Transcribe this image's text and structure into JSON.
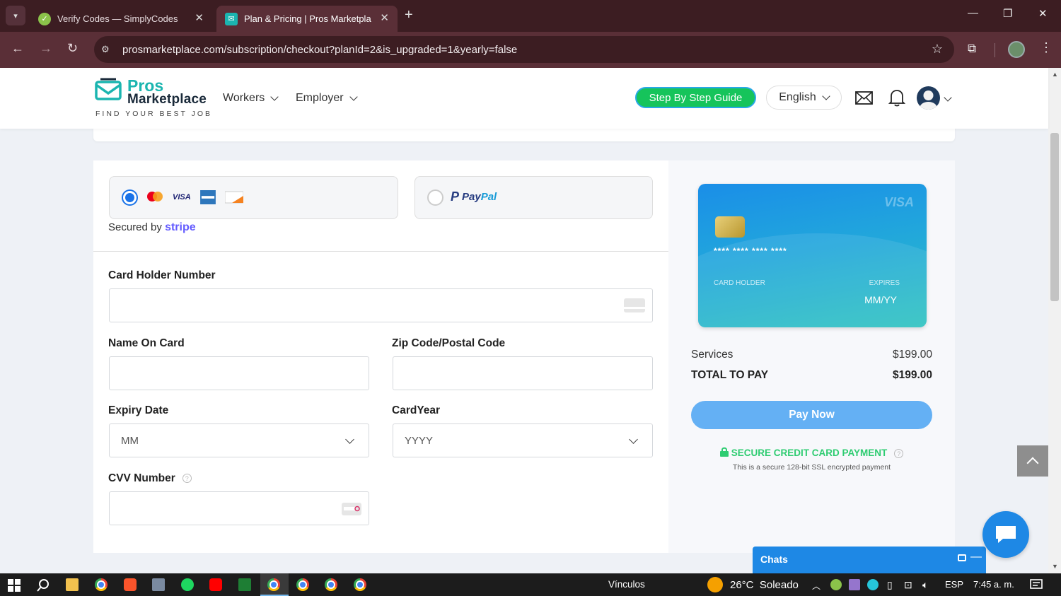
{
  "browser": {
    "tabs": [
      {
        "title": "Verify Codes — SimplyCodes",
        "active": false
      },
      {
        "title": "Plan & Pricing | Pros Marketplace",
        "active": true
      }
    ],
    "url": "prosmarketplace.com/subscription/checkout?planId=2&is_upgraded=1&yearly=false"
  },
  "header": {
    "logo_top": "Pros",
    "logo_bottom": "Marketplace",
    "logo_tagline": "FIND YOUR BEST JOB",
    "nav": [
      "Workers",
      "Employer"
    ],
    "guide_label": "Step By Step Guide",
    "language": "English"
  },
  "payment": {
    "card_brands": [
      "mastercard-icon",
      "visa-icon",
      "amex-icon",
      "discover-icon"
    ],
    "visa_text": "VISA",
    "paypal_left": "Pay",
    "paypal_right": "Pal",
    "secured_prefix": "Secured by",
    "secured_brand": "stripe"
  },
  "form": {
    "card_number_label": "Card Holder Number",
    "name_label": "Name On Card",
    "zip_label": "Zip Code/Postal Code",
    "expiry_label": "Expiry Date",
    "expiry_placeholder": "MM",
    "year_label": "CardYear",
    "year_placeholder": "YYYY",
    "cvv_label": "CVV Number",
    "help_mark": "?"
  },
  "card_preview": {
    "brand": "VISA",
    "number": "**** **** **** ****",
    "holder_label": "CARD HOLDER",
    "expires_label": "EXPIRES",
    "expires_value": "MM/YY"
  },
  "summary": {
    "services_label": "Services",
    "services_value": "$199.00",
    "total_label": "TOTAL TO PAY",
    "total_value": "$199.00",
    "pay_button": "Pay Now",
    "secure_title": "SECURE CREDIT CARD PAYMENT",
    "secure_sub": "This is a secure 128-bit SSL encrypted payment"
  },
  "chat": {
    "title": "Chats"
  },
  "taskbar": {
    "links_label": "Vínculos",
    "weather": "26°C  Soleado",
    "lang": "ESP",
    "time": "7:45 a. m."
  },
  "colors": {
    "accent_blue": "#1a73e8",
    "guide_green": "#16c45b",
    "pay_button": "#64b0f4",
    "secure_green": "#2ecc71",
    "browser_frame": "#5a2f37"
  }
}
